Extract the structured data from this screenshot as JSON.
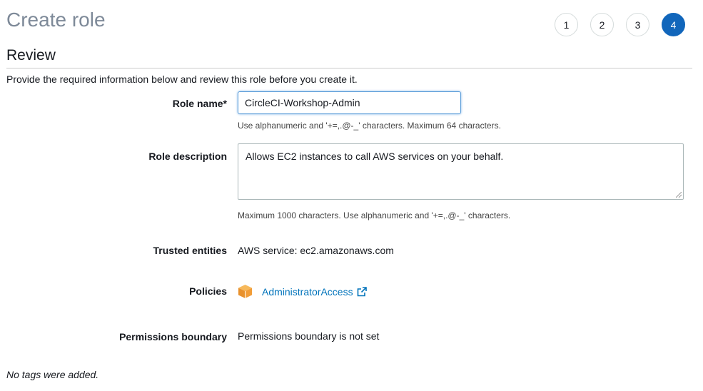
{
  "header": {
    "title": "Create role",
    "steps": [
      {
        "label": "1",
        "active": false
      },
      {
        "label": "2",
        "active": false
      },
      {
        "label": "3",
        "active": false
      },
      {
        "label": "4",
        "active": true
      }
    ]
  },
  "review": {
    "section_title": "Review",
    "intro": "Provide the required information below and review this role before you create it.",
    "role_name": {
      "label": "Role name*",
      "value": "CircleCI-Workshop-Admin",
      "hint": "Use alphanumeric and '+=,.@-_' characters. Maximum 64 characters."
    },
    "role_description": {
      "label": "Role description",
      "value": "Allows EC2 instances to call AWS services on your behalf.",
      "hint": "Maximum 1000 characters. Use alphanumeric and '+=,.@-_' characters."
    },
    "trusted_entities": {
      "label": "Trusted entities",
      "value": "AWS service: ec2.amazonaws.com"
    },
    "policies": {
      "label": "Policies",
      "items": [
        {
          "name": "AdministratorAccess",
          "icon": "aws-policy-cube-icon",
          "link_icon": "external-link-icon"
        }
      ]
    },
    "permissions_boundary": {
      "label": "Permissions boundary",
      "value": "Permissions boundary is not set"
    },
    "tags_note": "No tags were added."
  },
  "colors": {
    "accent": "#1166bb",
    "link": "#0073bb",
    "policy_icon": "#f29d38"
  }
}
